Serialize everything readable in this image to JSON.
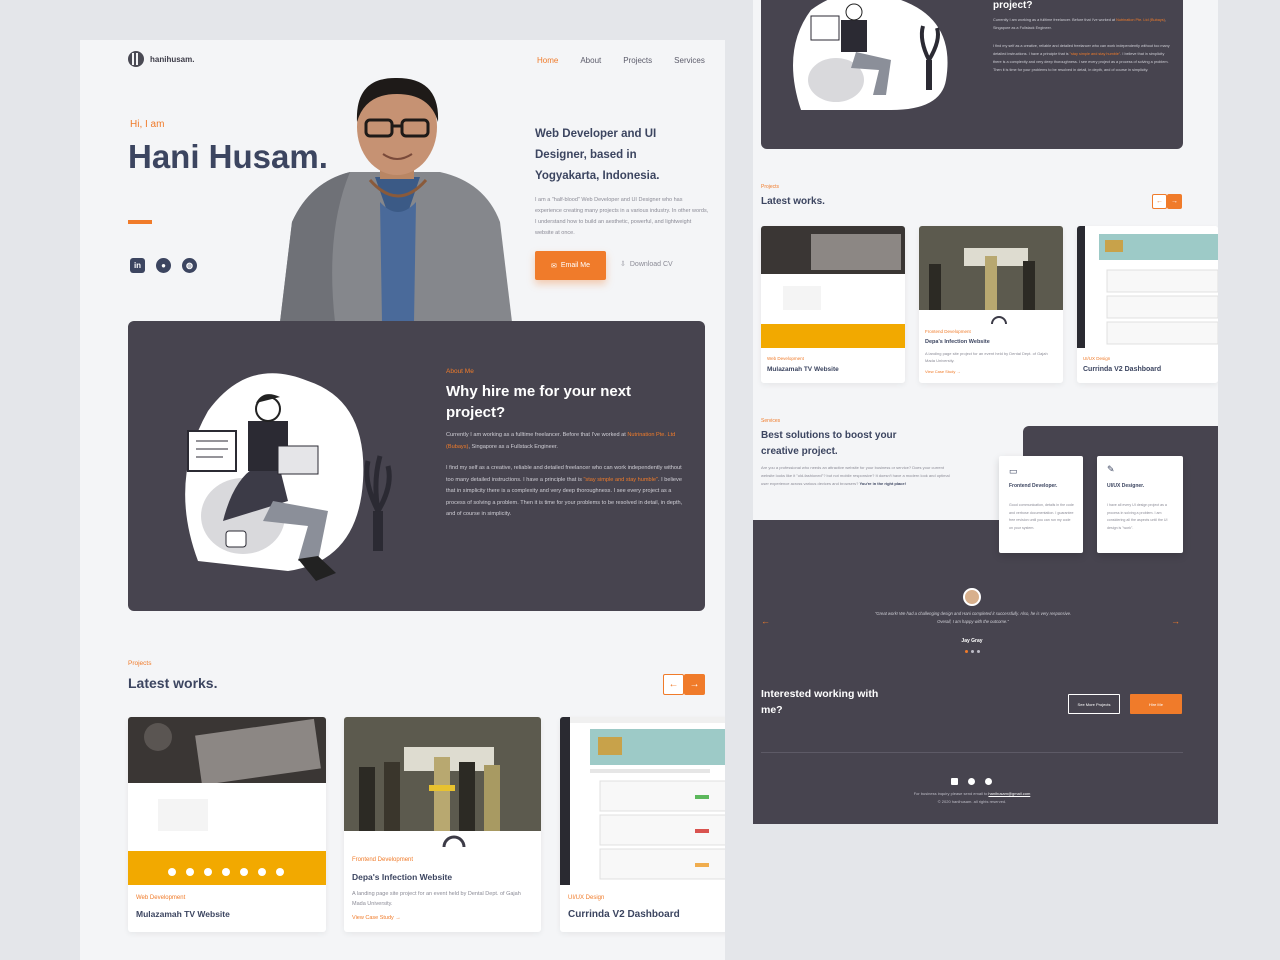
{
  "brand": {
    "logo_text": "hanihusam.",
    "accent": "#f07b2a",
    "navy": "#3c4560",
    "dark": "#47444f"
  },
  "nav": {
    "items": [
      "Home",
      "About",
      "Projects",
      "Services"
    ],
    "active": "Home"
  },
  "hero": {
    "greeting": "Hi, I am",
    "name": "Hani Husam.",
    "tagline": "Web Developer and UI Designer, based in Yogyakarta, Indonesia.",
    "intro": "I am a \"half-blood\" Web Developer and UI Designer who has experience creating many projects in a various industry. In other words, I understand how to build an aesthetic, powerful, and lightweight website at once.",
    "email_button": "Email Me",
    "cv_button": "Download CV",
    "socials": [
      "linkedin-icon",
      "github-icon",
      "dribbble-icon"
    ]
  },
  "about": {
    "eyebrow": "About Me",
    "title": "Why hire me for your next project?",
    "p1_a": "Currently I am working as a fulltime freelancer. Before that I've worked at ",
    "p1_company": "Nutrination Pte. Ltd (Bubays)",
    "p1_b": ", Singapore as a Fullstack Engineer.",
    "p2_a": "I find my self as a creative, reliable and detailed freelancer who can work independently without too many detailed instructions. I have a principle that is ",
    "p2_quote": "\"stay simple and stay humble\"",
    "p2_b": ". I believe that in simplicity there is a complexity and very deep thoroughness. I see every project as a process of solving a problem. Then it is time for your problems to be resolved in detail, in depth, and of course in simplicity."
  },
  "projects": {
    "eyebrow": "Projects",
    "title": "Latest works.",
    "items": [
      {
        "category": "Web Development",
        "title": "Mulazamah TV Website",
        "desc": "",
        "link": ""
      },
      {
        "category": "Frontend Development",
        "title": "Depa's Infection Website",
        "desc": "A landing page site project for an event held by Dental Dept. of Gajah Mada University.",
        "link": "View Case Study"
      },
      {
        "category": "UI/UX Design",
        "title": "Currinda V2 Dashboard",
        "desc": "",
        "link": ""
      }
    ]
  },
  "right": {
    "about_title": "project?",
    "services": {
      "eyebrow": "Services",
      "title": "Best solutions to boost your creative project.",
      "desc": "Are you a professional who needs an attractive website for your business or service? Does your current website looks like it \"old-fashioned\"? but not mobile responsive? It doesn't have a modern look and optimal user experience across various devices and browsers?",
      "desc_end": "You're in the right place!",
      "cards": [
        {
          "title": "Frontend Developer.",
          "desc": "Good communication, details in the code and verbose documentation. I guarantee free revision until you can run my code on your system."
        },
        {
          "title": "UI/UX Designer.",
          "desc": "I have all every UI design project as a process in solving a problem. I am considering all the aspects until the UI design is \"work\"."
        }
      ]
    },
    "testimonial": {
      "quote": "\"Great work! We had a challenging design and Hani completed it successfully. Also, he is very responsive. Overall, I am happy with the outcome.\"",
      "name": "Jay Gray"
    },
    "cta": {
      "text": "Interested working with me?",
      "projects_button": "See More Projects",
      "hire_button": "Hire Me"
    },
    "footer": {
      "text": "For business inquiry please send email to",
      "email": "hanihusam@gmail.com",
      "copyright": "© 2020 hanihusam. all rights reserved."
    }
  }
}
